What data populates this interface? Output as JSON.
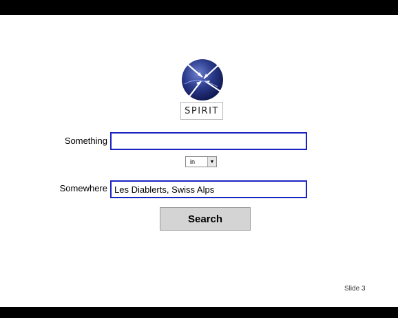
{
  "logo": {
    "text": "SPIRIT",
    "globe_color": "#2a3a8a"
  },
  "form": {
    "something_label": "Something",
    "something_value": "",
    "connector_select_value": "in",
    "somewhere_label": "Somewhere",
    "somewhere_value": "Les Diablerts, Swiss Alps",
    "search_label": "Search"
  },
  "footer": {
    "slide_label": "Slide 3"
  },
  "colors": {
    "field_border": "#1b22c2",
    "bars": "#000000",
    "button_bg": "#d4d4d4"
  }
}
